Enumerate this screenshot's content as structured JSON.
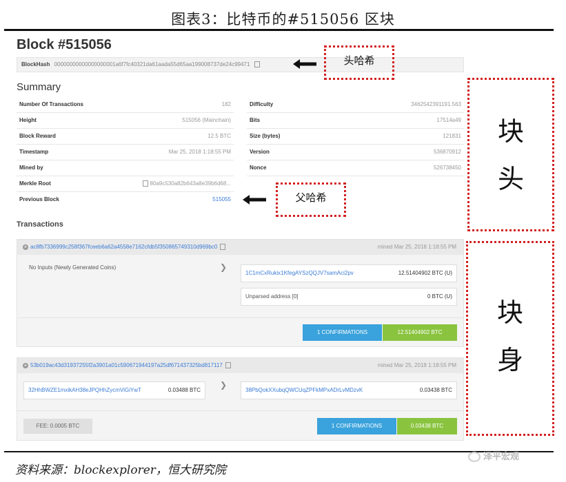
{
  "caption": "图表3：比特币的#515056 区块",
  "block_title": "Block #515056",
  "blockhash": {
    "label": "BlockHash",
    "value": "00000000000000000001a6f7fc40321da61aada55d65aa199008737de24c99471"
  },
  "summary_title": "Summary",
  "summary_left": [
    {
      "key": "Number Of Transactions",
      "value": "182"
    },
    {
      "key": "Height",
      "value": "515056 (Mainchain)"
    },
    {
      "key": "Block Reward",
      "value": "12.5 BTC"
    },
    {
      "key": "Timestamp",
      "value": "Mar 25, 2018 1:18:55 PM"
    },
    {
      "key": "Mined by",
      "value": ""
    },
    {
      "key": "Merkle Root",
      "value": "80a9c530a82b643a8e39b6d68..."
    },
    {
      "key": "Previous Block",
      "value": "515055"
    }
  ],
  "summary_right": [
    {
      "key": "Difficulty",
      "value": "3462542391191.563"
    },
    {
      "key": "Bits",
      "value": "17514a49"
    },
    {
      "key": "Size (bytes)",
      "value": "121831"
    },
    {
      "key": "Version",
      "value": "536870912"
    },
    {
      "key": "Nonce",
      "value": "526738450"
    }
  ],
  "transactions_title": "Transactions",
  "tx1": {
    "hash": "ac8fb7336999c258f367fceeb6a62a4558e7162cfdb5f350865749310d969bc0",
    "mined": "mined Mar 25, 2018 1:18:55 PM",
    "input": "No Inputs (Newly Generated Coins)",
    "outputs": [
      {
        "address": "1C1mCxRukix1KfegAYSzQQJV7samAci2pv",
        "amount": "12.51404902 BTC (U)"
      },
      {
        "address": "Unparsed address [0]",
        "amount": "0 BTC (U)"
      }
    ],
    "confirmations": "1 CONFIRMATIONS",
    "total": "12.51404902 BTC"
  },
  "tx2": {
    "hash": "53b019ac43d31937255f2a3901a01c590671944197a25df671437325bd817117",
    "mined": "mined Mar 25, 2018 1:18:55 PM",
    "input_address": "32HhBWZE1mxikAH38eJPQHhZycmViGiYwT",
    "input_amount": "0.03488 BTC",
    "output_address": "38PbQokXXubqQWCUqZPFkMPxADrLvMDzvK",
    "output_amount": "0.03438 BTC",
    "fee": "FEE: 0.0005 BTC",
    "confirmations": "1 CONFIRMATIONS",
    "total": "0.03438 BTC"
  },
  "annotations": {
    "header_hash": "头哈希",
    "parent_hash": "父哈希",
    "block_header": [
      "块",
      "头"
    ],
    "block_body": [
      "块",
      "身"
    ]
  },
  "source": "资料来源：blockexplorer，恒大研究院",
  "watermark": "泽平宏观",
  "colors": {
    "annotation_red": "#d21f1f",
    "link_blue": "#3a7bd5",
    "confirm_blue": "#3aa2dc",
    "total_green": "#8ac43f"
  }
}
